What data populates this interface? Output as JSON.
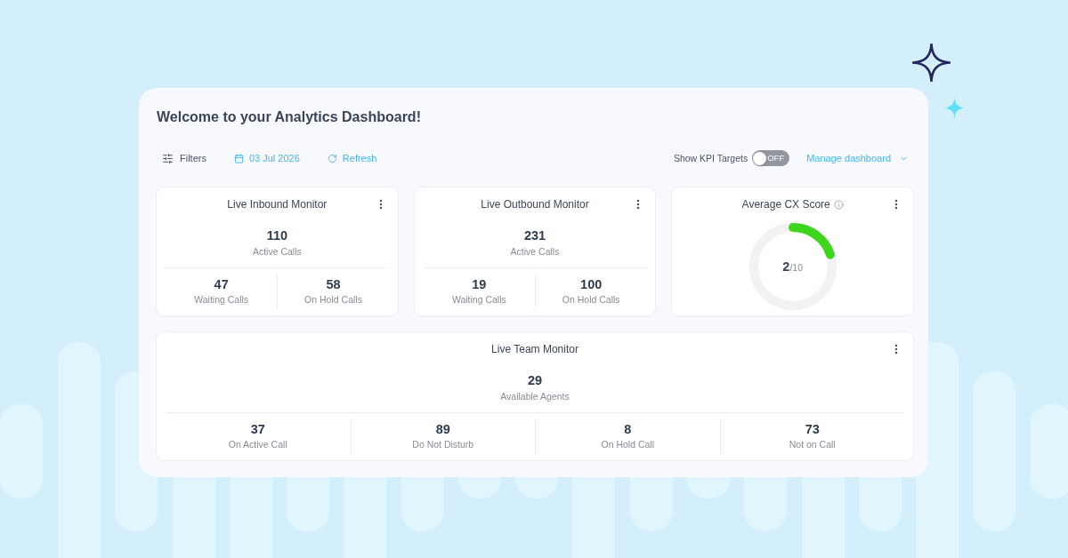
{
  "dashboard": {
    "title": "Welcome to your Analytics Dashboard!"
  },
  "toolbar": {
    "filters_label": "Filters",
    "date": "03 Jul 2026",
    "refresh_label": "Refresh",
    "kpi_targets": {
      "label": "Show KPI Targets",
      "on": false,
      "state_text": "OFF"
    },
    "manage_label": "Manage dashboard"
  },
  "widget_rows": [
    [
      {
        "kind": "counts",
        "title": "Live Inbound Monitor",
        "primary": {
          "value": "110",
          "label": "Active Calls"
        },
        "stats": [
          {
            "value": "47",
            "label": "Waiting Calls"
          },
          {
            "value": "58",
            "label": "On Hold Calls"
          }
        ]
      },
      {
        "kind": "counts",
        "title": "Live Outbound Monitor",
        "primary": {
          "value": "231",
          "label": "Active Calls"
        },
        "stats": [
          {
            "value": "19",
            "label": "Waiting Calls"
          },
          {
            "value": "100",
            "label": "On Hold Calls"
          }
        ]
      },
      {
        "kind": "gauge",
        "title": "Average CX Score",
        "score": {
          "value": "2",
          "scale": "/10",
          "level": 0.2
        }
      }
    ],
    [
      {
        "kind": "counts",
        "title": "Live Team Monitor",
        "primary": {
          "value": "29",
          "label": "Available Agents"
        },
        "stats": [
          {
            "value": "37",
            "label": "On Active Call"
          },
          {
            "value": "89",
            "label": "Do Not Disturb"
          },
          {
            "value": "8",
            "label": "On Hold Call"
          },
          {
            "value": "73",
            "label": "Not on Call"
          }
        ]
      }
    ]
  ]
}
